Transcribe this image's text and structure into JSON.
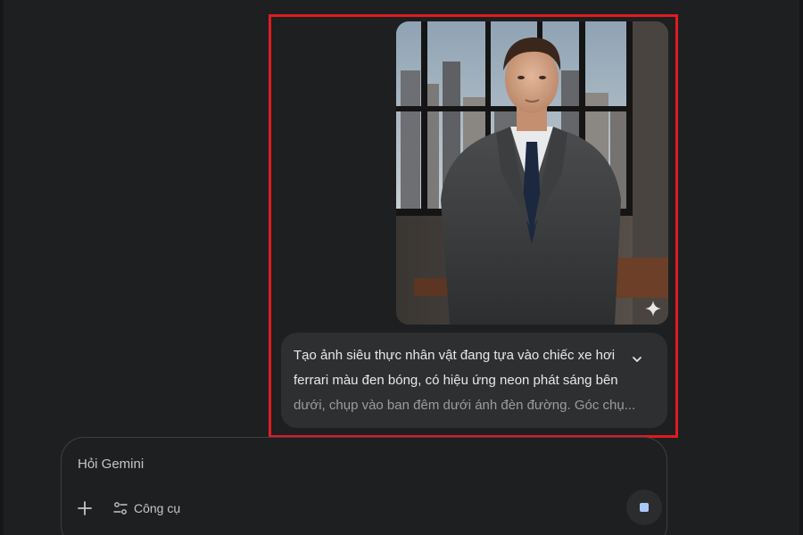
{
  "chat": {
    "generated_image": {
      "description": "Photorealistic man in a dark grey suit standing in an office in front of city windows",
      "icon": "sparkle-icon"
    },
    "prompt_lines": [
      "Tạo ảnh siêu thực nhân vật đang tựa vào chiếc xe hơi",
      "ferrari màu đen bóng, có hiệu ứng neon phát sáng bên",
      "dưới, chụp vào ban đêm dưới ánh đèn đường. Góc chụ..."
    ],
    "expand_icon": "chevron-down-icon"
  },
  "input": {
    "placeholder": "Hỏi Gemini",
    "tools_label": "Công cụ",
    "add_icon": "plus-icon",
    "tools_icon": "tune-icon",
    "stop_icon": "stop-icon"
  },
  "colors": {
    "background": "#1e1f20",
    "bubble": "#2d2f31",
    "highlight": "#e01b22",
    "stop_accent": "#a8c7fa"
  }
}
